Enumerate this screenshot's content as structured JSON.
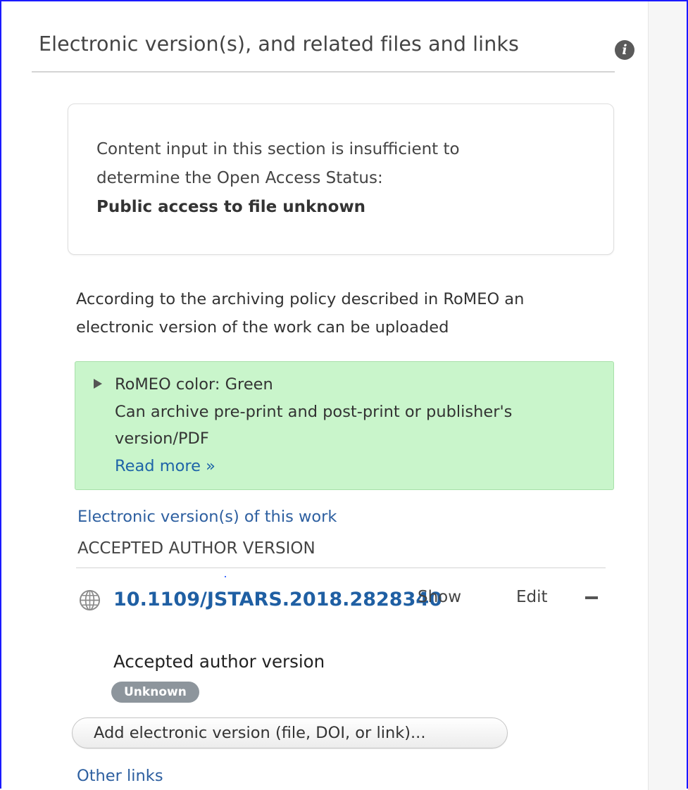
{
  "section": {
    "title": "Electronic version(s), and related files and links",
    "info_icon": "info-icon"
  },
  "open_access": {
    "line1": "Content input in this section is insufficient to",
    "line2": "determine the Open Access Status:",
    "status": "Public access to file unknown"
  },
  "policy": {
    "line1": "According to the archiving policy described in RoMEO an",
    "line2": "electronic version of the work can be uploaded"
  },
  "romeo": {
    "expand_icon": "triangle-right-icon",
    "color_line": "RoMEO color: Green",
    "desc_line1": "Can archive pre-print and post-print or publisher's",
    "desc_line2": "version/PDF",
    "read_more": "Read more »",
    "box_color": "#c9f5cb"
  },
  "electronic_versions": {
    "link_label": "Electronic version(s) of this work",
    "heading": "ACCEPTED AUTHOR VERSION",
    "item": {
      "icon": "globe-icon",
      "doi": "10.1109/JSTARS.2018.2828340",
      "show_label": "Show",
      "edit_label": "Edit",
      "remove_icon": "minus-icon",
      "version_label": "Accepted author version",
      "badge": "Unknown"
    },
    "add_button": "Add electronic version (file, DOI, or link)...",
    "other_links": "Other links"
  },
  "colors": {
    "link": "#1f5fa3",
    "badge": "#8d959c",
    "frame_border": "#1a1aff"
  }
}
